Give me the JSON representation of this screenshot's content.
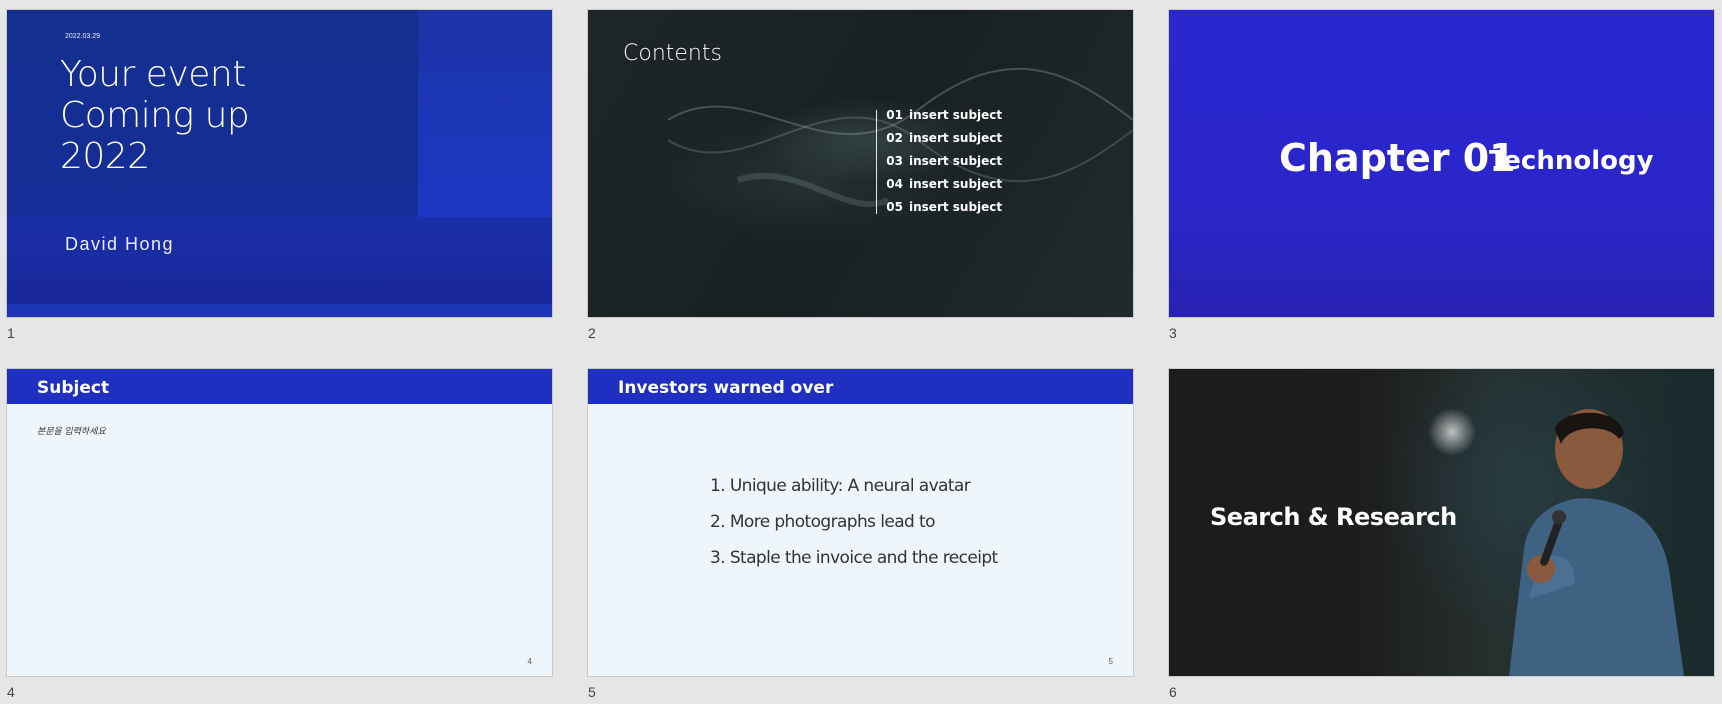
{
  "slides": [
    {
      "number": "1",
      "date": "2022.03.29",
      "title_lines": [
        "Your event",
        "Coming up",
        "2022"
      ],
      "author": "David Hong"
    },
    {
      "number": "2",
      "title": "Contents",
      "toc": [
        {
          "num": "01",
          "label": "insert subject"
        },
        {
          "num": "02",
          "label": "insert subject"
        },
        {
          "num": "03",
          "label": "insert subject"
        },
        {
          "num": "04",
          "label": "insert subject"
        },
        {
          "num": "05",
          "label": "insert subject"
        }
      ]
    },
    {
      "number": "3",
      "chapter": "Chapter 01",
      "subtitle": "Technology"
    },
    {
      "number": "4",
      "header": "Subject",
      "body": "본문을 입력하세요",
      "page": "4"
    },
    {
      "number": "5",
      "header": "Investors warned over",
      "items": [
        "1. Unique ability: A neural avatar",
        "2. More photographs lead to",
        "3. Staple the invoice and the receipt"
      ],
      "page": "5"
    },
    {
      "number": "6",
      "title": "Search & Research"
    }
  ],
  "colors": {
    "app_background": "#e6e6e6",
    "accent_blue": "#1f2fc0",
    "chapter_blue": "#2a27cf"
  }
}
